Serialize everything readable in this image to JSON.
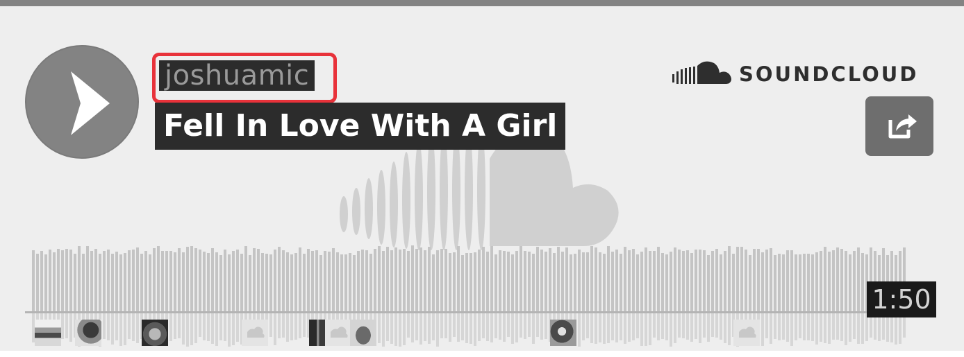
{
  "player": {
    "username": "joshuamic",
    "track_title": "Fell In Love With A Girl",
    "brand": "SOUNDCLOUD",
    "duration": "1:50"
  },
  "icons": {
    "play": "play-icon",
    "share": "share-icon",
    "brand_logo": "soundcloud-logo-icon"
  },
  "colors": {
    "highlight": "#e8323a",
    "label_bg": "#2c2c2c",
    "waveform": "#c4c4c4",
    "background": "#eeeeee"
  }
}
